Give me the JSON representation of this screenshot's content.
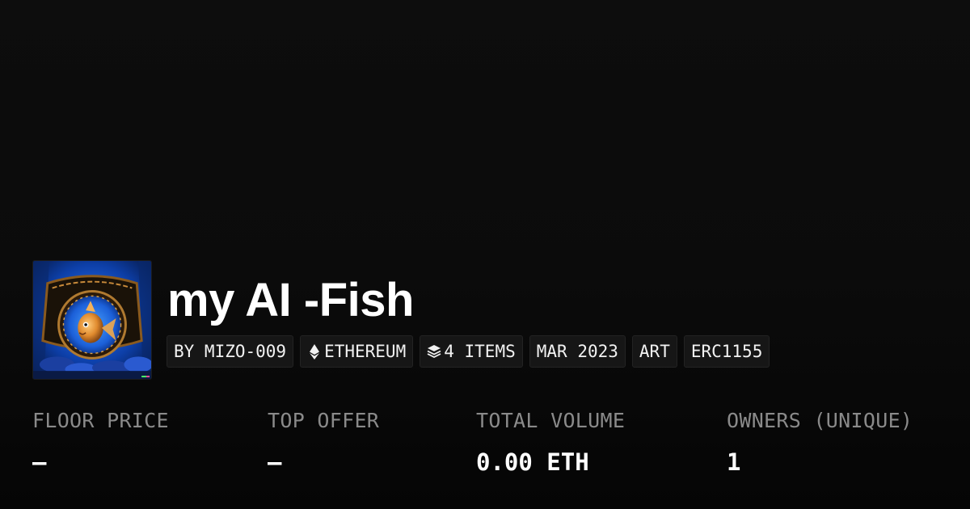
{
  "collection": {
    "name": "my AI -Fish",
    "thumbnail_icon": "fish-artwork-image"
  },
  "tags": {
    "creator": "BY MIZO-009",
    "chain": "ETHEREUM",
    "chain_icon": "ethereum-icon",
    "items": "4 ITEMS",
    "items_icon": "layers-icon",
    "date": "MAR 2023",
    "category": "ART",
    "standard": "ERC1155"
  },
  "stats": [
    {
      "label": "FLOOR PRICE",
      "value": "–"
    },
    {
      "label": "TOP OFFER",
      "value": "–"
    },
    {
      "label": "TOTAL VOLUME",
      "value": "0.00 ETH"
    },
    {
      "label": "OWNERS (UNIQUE)",
      "value": "1"
    }
  ],
  "colors": {
    "background": "#0b0b0b",
    "tag_background": "#161616",
    "label": "#8a8a8a",
    "text": "#ffffff"
  }
}
